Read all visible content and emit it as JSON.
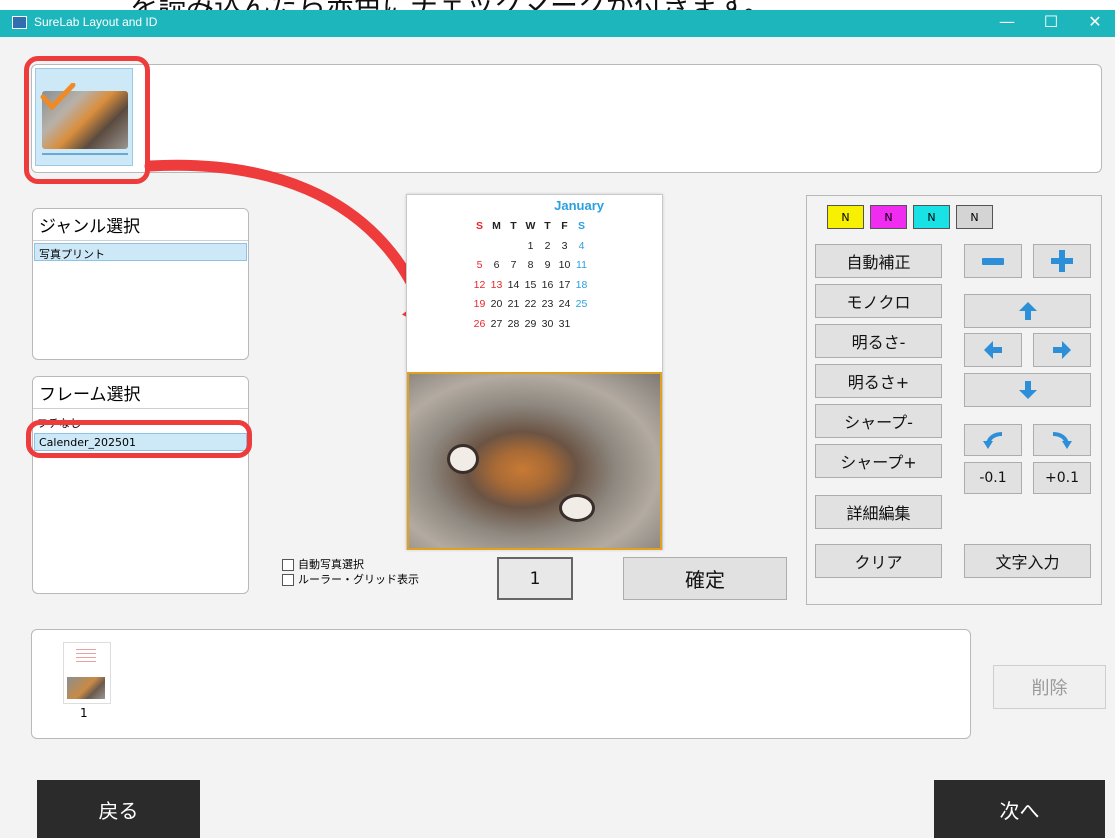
{
  "window": {
    "title": "SureLab Layout and ID",
    "controls": {
      "minimize": "—",
      "maximize": "☐",
      "close": "✕"
    },
    "top_caption": "を読み込んだら赤色にチェックマークが付きます。"
  },
  "genre": {
    "header": "ジャンル選択",
    "items": [
      "写真プリント"
    ]
  },
  "frame": {
    "header": "フレーム選択",
    "items": [
      "フチなし",
      "Calender_202501"
    ]
  },
  "calendar": {
    "month": "January",
    "weekdays": [
      "S",
      "M",
      "T",
      "W",
      "T",
      "F",
      "S"
    ],
    "weeks": [
      [
        "",
        "",
        "",
        "1",
        "2",
        "3",
        "4"
      ],
      [
        "5",
        "6",
        "7",
        "8",
        "9",
        "10",
        "11"
      ],
      [
        "12",
        "13",
        "14",
        "15",
        "16",
        "17",
        "18"
      ],
      [
        "19",
        "20",
        "21",
        "22",
        "23",
        "24",
        "25"
      ],
      [
        "26",
        "27",
        "28",
        "29",
        "30",
        "31",
        ""
      ]
    ],
    "colors": {
      "sunday": "#e8262b",
      "saturday": "#2aa0e0",
      "holiday": "#e8262b",
      "month": "#2aa0e0"
    }
  },
  "checkboxes": {
    "auto_photo": "自動写真選択",
    "ruler_grid": "ルーラー・グリッド表示"
  },
  "copies": "1",
  "confirm_label": "確定",
  "color_channels": [
    {
      "label": "N",
      "color": "#f7f000"
    },
    {
      "label": "N",
      "color": "#f02cf0"
    },
    {
      "label": "N",
      "color": "#19e2e6"
    },
    {
      "label": "N",
      "color": "#d4d4d4"
    }
  ],
  "edit_buttons": {
    "auto_correct": "自動補正",
    "mono": "モノクロ",
    "bright_minus": "明るさ-",
    "bright_plus": "明るさ+",
    "sharp_minus": "シャープ-",
    "sharp_plus": "シャープ+",
    "detail_edit": "詳細編集",
    "clear": "クリア",
    "text_input": "文字入力",
    "rot_minus": "-0.1",
    "rot_plus": "+0.1"
  },
  "page_strip": {
    "page_number": "1"
  },
  "delete_label": "削除",
  "nav": {
    "back": "戻る",
    "next": "次へ"
  },
  "accent_colors": {
    "titlebar": "#1eb6bd",
    "annotation": "#ee3b3b",
    "arrow_blue": "#2d8fd8",
    "photo_border": "#e0a020"
  }
}
